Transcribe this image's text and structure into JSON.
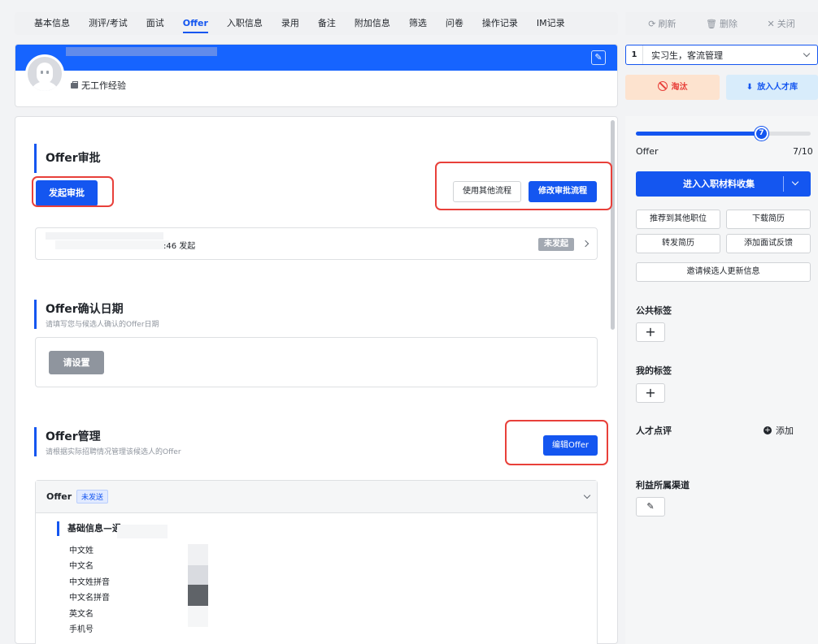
{
  "tabs": [
    "基本信息",
    "测评/考试",
    "面试",
    "Offer",
    "入职信息",
    "录用",
    "备注",
    "附加信息",
    "筛选",
    "问卷",
    "操作记录",
    "IM记录"
  ],
  "active_tab": "Offer",
  "profile": {
    "experience": "无工作经验"
  },
  "approval": {
    "title": "Offer审批",
    "start_button": "发起审批",
    "other_flow_button": "使用其他流程",
    "edit_flow_button": "修改审批流程",
    "record_time": ":46 发起",
    "record_status": "未发起"
  },
  "confirm_date": {
    "title": "Offer确认日期",
    "desc": "请填写您与候选人确认的Offer日期",
    "set_button": "请设置"
  },
  "offer_manage": {
    "title": "Offer管理",
    "desc": "请根据实际招聘情况管理该候选人的Offer",
    "edit_button": "编辑Offer",
    "card_title": "Offer",
    "card_status": "未发送",
    "basic_info_title": "基础信息—通",
    "fields": [
      "中文姓",
      "中文名",
      "中文姓拼音",
      "中文名拼音",
      "英文名",
      "手机号"
    ]
  },
  "right": {
    "refresh": "刷新",
    "delete": "删除",
    "close": "关闭",
    "stage_num": "1",
    "stage_text": "实习生，客流管理",
    "eliminate": "淘汰",
    "to_pool": "放入人才库",
    "progress_label": "Offer",
    "progress_count": "7/10",
    "progress_step": "7",
    "progress_fraction": 0.7,
    "onboard_button": "进入入职材料收集",
    "recommend": "推荐到其他职位",
    "download": "下载简历",
    "forward": "转发简历",
    "add_feedback": "添加面试反馈",
    "invite_update": "邀请候选人更新信息",
    "public_tags": "公共标签",
    "my_tags": "我的标签",
    "talent_review": "人才点评",
    "add": "添加",
    "channel": "利益所属渠道"
  },
  "colors": {
    "accent": "#1456f0",
    "annotation": "#e8403a",
    "eliminate_bg": "#fde3cf",
    "pool_bg": "#d8ecfb"
  }
}
